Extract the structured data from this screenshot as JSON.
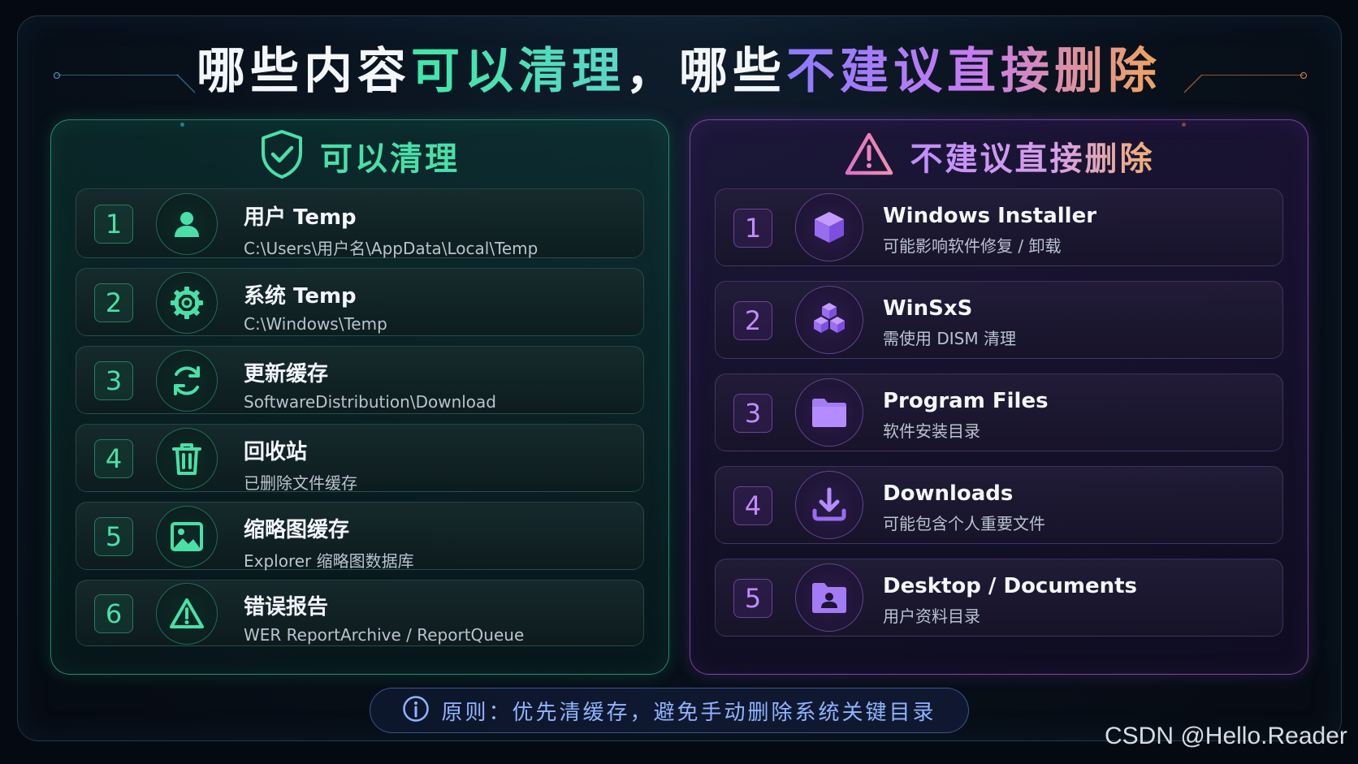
{
  "title": {
    "part1": "哪些内容",
    "part2": "可以清理",
    "part3": "，哪些",
    "part4": "不建议直接删除"
  },
  "left_panel": {
    "heading": "可以清理",
    "icon": "shield-check-icon",
    "items": [
      {
        "num": "1",
        "title": "用户 Temp",
        "sub": "C:\\Users\\用户名\\AppData\\Local\\Temp",
        "icon": "user-icon"
      },
      {
        "num": "2",
        "title": "系统 Temp",
        "sub": "C:\\Windows\\Temp",
        "icon": "gear-icon"
      },
      {
        "num": "3",
        "title": "更新缓存",
        "sub": "SoftwareDistribution\\Download",
        "icon": "refresh-icon"
      },
      {
        "num": "4",
        "title": "回收站",
        "sub": "已删除文件缓存",
        "icon": "trash-icon"
      },
      {
        "num": "5",
        "title": "缩略图缓存",
        "sub": "Explorer 缩略图数据库",
        "icon": "image-icon"
      },
      {
        "num": "6",
        "title": "错误报告",
        "sub": "WER ReportArchive / ReportQueue",
        "icon": "warning-icon"
      }
    ]
  },
  "right_panel": {
    "heading": "不建议直接删除",
    "icon": "warning-icon",
    "items": [
      {
        "num": "1",
        "title": "Windows Installer",
        "sub": "可能影响软件修复 / 卸载",
        "icon": "cube-icon"
      },
      {
        "num": "2",
        "title": "WinSxS",
        "sub": "需使用 DISM 清理",
        "icon": "cubes-icon"
      },
      {
        "num": "3",
        "title": "Program Files",
        "sub": "软件安装目录",
        "icon": "folder-icon"
      },
      {
        "num": "4",
        "title": "Downloads",
        "sub": "可能包含个人重要文件",
        "icon": "download-icon"
      },
      {
        "num": "5",
        "title": "Desktop / Documents",
        "sub": "用户资料目录",
        "icon": "user-folder-icon"
      }
    ]
  },
  "footer": {
    "text": "原则：优先清缓存，避免手动删除系统关键目录",
    "icon": "info-icon"
  },
  "watermark": "CSDN @Hello.Reader",
  "colors": {
    "green_accent": "#49e0a8",
    "purple_accent": "#c08cff",
    "orange_accent": "#f0a35a",
    "background": "#050a12"
  }
}
